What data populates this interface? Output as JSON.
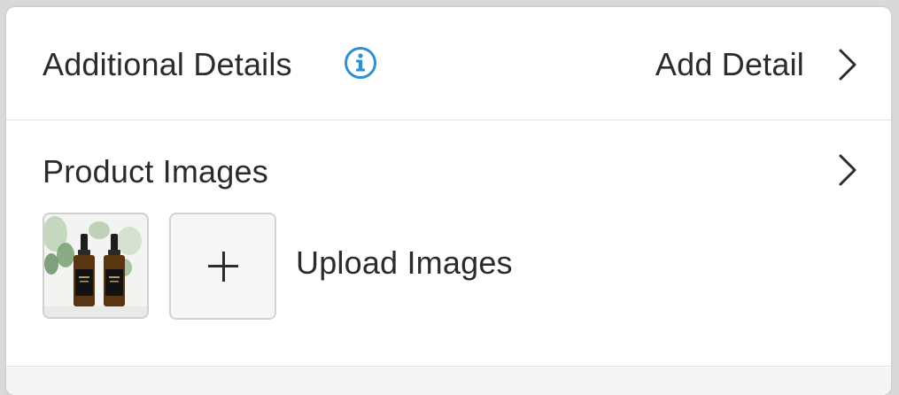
{
  "additional_details": {
    "title": "Additional Details",
    "info_icon": "info-circle-icon",
    "action_label": "Add Detail",
    "chevron_icon": "chevron-right-icon"
  },
  "product_images": {
    "title": "Product Images",
    "chevron_icon": "chevron-right-icon",
    "thumbnail_alt": "product-thumbnail",
    "upload_icon": "plus-icon",
    "upload_label": "Upload Images"
  },
  "colors": {
    "info_blue": "#2f8fd0",
    "text": "#2b2b2b",
    "divider": "#e1e1e1"
  }
}
